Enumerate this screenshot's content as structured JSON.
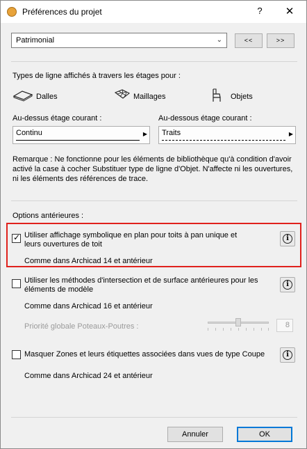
{
  "window": {
    "title": "Préférences du projet",
    "help": "?",
    "close": "✕"
  },
  "preset": {
    "selected": "Patrimonial",
    "prev_label": "<<",
    "next_label": ">>"
  },
  "line_types": {
    "heading": "Types de ligne affichés à travers les étages pour :",
    "categories": [
      {
        "label": "Dalles",
        "icon": "slab-icon"
      },
      {
        "label": "Maillages",
        "icon": "mesh-icon"
      },
      {
        "label": "Objets",
        "icon": "chair-object-icon"
      }
    ],
    "above": {
      "label": "Au-dessus étage courant :",
      "value": "Continu",
      "style": "solid"
    },
    "below": {
      "label": "Au-dessous étage courant :",
      "value": "Traits",
      "style": "dashed"
    },
    "remark": "Remarque : Ne fonctionne pour les éléments de bibliothèque qu'à condition d'avoir activé la case à cocher Substituer type de ligne d'Objet. N'affecte ni les ouvertures, ni les éléments des références de trace."
  },
  "legacy": {
    "heading": "Options antérieures :",
    "options": [
      {
        "label": "Utiliser affichage symbolique en plan pour toits à pan unique et leurs ouvertures de toit",
        "note": "Comme dans Archicad 14 et antérieur",
        "checked": true,
        "highlighted": true
      },
      {
        "label": "Utiliser les méthodes d'intersection et de surface antérieures pour les éléments de modèle",
        "note": "Comme dans Archicad 16 et antérieur",
        "checked": false
      },
      {
        "label": "Masquer Zones et leurs étiquettes associées dans vues de type Coupe",
        "note": "Comme dans Archicad 24 et antérieur",
        "checked": false
      }
    ],
    "priority": {
      "label": "Priorité globale Poteaux-Poutres :",
      "value": "8",
      "enabled": false,
      "level_fraction": 0.5
    }
  },
  "info_symbol": "i",
  "footer": {
    "cancel": "Annuler",
    "ok": "OK"
  },
  "colors": {
    "highlight": "#e0211c",
    "primary_border": "#0078d7"
  }
}
